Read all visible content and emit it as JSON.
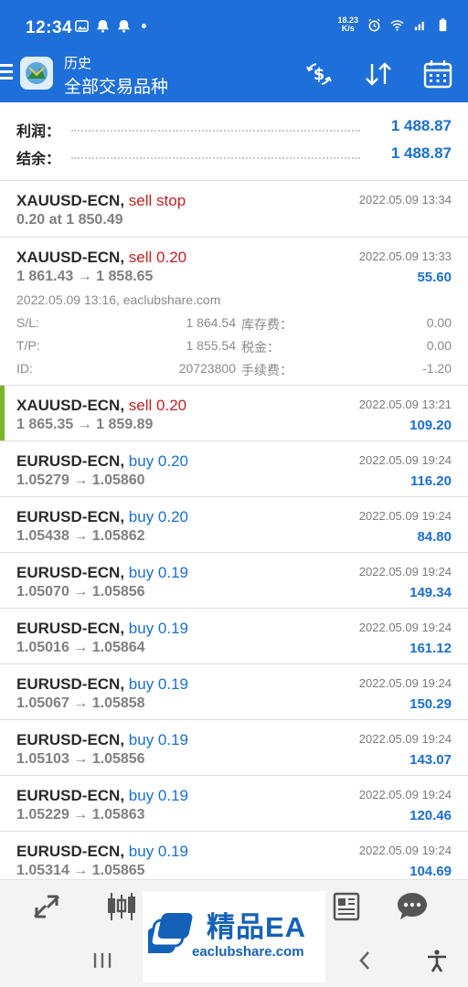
{
  "status_bar": {
    "time": "12:34",
    "speed_top": "18.23",
    "speed_bottom": "K/s",
    "left_icons": [
      "gallery-icon",
      "notification-icon",
      "notification-icon",
      "dot-indicator"
    ],
    "right_icons": [
      "alarm-icon",
      "wifi-icon",
      "signal-icon",
      "battery-icon"
    ]
  },
  "app_bar": {
    "subtitle": "历史",
    "title": "全部交易品种",
    "actions": [
      "currency-exchange-icon",
      "sort-icon",
      "calendar-icon"
    ],
    "bg_color": "#1e6fd9"
  },
  "summary": {
    "profit_label": "利润：",
    "profit_value": "1 488.87",
    "balance_label": "结余：",
    "balance_value": "1 488.87"
  },
  "trades": [
    {
      "symbol": "XAUUSD-ECN,",
      "side": "sell stop",
      "side_type": "sell",
      "date": "2022.05.09 13:34",
      "price": "0.20 at 1 850.49",
      "profit": ""
    },
    {
      "symbol": "XAUUSD-ECN,",
      "side": "sell 0.20",
      "side_type": "sell",
      "date": "2022.05.09 13:33",
      "price": "1 861.43 → 1 858.65",
      "profit": "55.60",
      "details": {
        "open_info": "2022.05.09 13:16, eaclubshare.com",
        "sl_label": "S/L:",
        "sl_value": "1 864.54",
        "swap_label": "库存费：",
        "swap_value": "0.00",
        "tp_label": "T/P:",
        "tp_value": "1 855.54",
        "tax_label": "税金：",
        "tax_value": "0.00",
        "id_label": "ID:",
        "id_value": "20723800",
        "fee_label": "手续费：",
        "fee_value": "-1.20"
      }
    },
    {
      "symbol": "XAUUSD-ECN,",
      "side": "sell 0.20",
      "side_type": "sell",
      "date": "2022.05.09 13:21",
      "price": "1 865.35 → 1 859.89",
      "profit": "109.20"
    },
    {
      "symbol": "EURUSD-ECN,",
      "side": "buy 0.20",
      "side_type": "buy",
      "date": "2022.05.09 19:24",
      "price": "1.05279 → 1.05860",
      "profit": "116.20"
    },
    {
      "symbol": "EURUSD-ECN,",
      "side": "buy 0.20",
      "side_type": "buy",
      "date": "2022.05.09 19:24",
      "price": "1.05438 → 1.05862",
      "profit": "84.80"
    },
    {
      "symbol": "EURUSD-ECN,",
      "side": "buy 0.19",
      "side_type": "buy",
      "date": "2022.05.09 19:24",
      "price": "1.05070 → 1.05856",
      "profit": "149.34"
    },
    {
      "symbol": "EURUSD-ECN,",
      "side": "buy 0.19",
      "side_type": "buy",
      "date": "2022.05.09 19:24",
      "price": "1.05016 → 1.05864",
      "profit": "161.12"
    },
    {
      "symbol": "EURUSD-ECN,",
      "side": "buy 0.19",
      "side_type": "buy",
      "date": "2022.05.09 19:24",
      "price": "1.05067 → 1.05858",
      "profit": "150.29"
    },
    {
      "symbol": "EURUSD-ECN,",
      "side": "buy 0.19",
      "side_type": "buy",
      "date": "2022.05.09 19:24",
      "price": "1.05103 → 1.05856",
      "profit": "143.07"
    },
    {
      "symbol": "EURUSD-ECN,",
      "side": "buy 0.19",
      "side_type": "buy",
      "date": "2022.05.09 19:24",
      "price": "1.05229 → 1.05863",
      "profit": "120.46"
    },
    {
      "symbol": "EURUSD-ECN,",
      "side": "buy 0.19",
      "side_type": "buy",
      "date": "2022.05.09 19:24",
      "price": "1.05314 → 1.05865",
      "profit": "104.69"
    }
  ],
  "bottom_nav": [
    "quotes-icon",
    "chart-icon",
    "trade-icon",
    "history-icon",
    "news-icon",
    "chat-icon"
  ],
  "system_nav": [
    "recent-apps-icon",
    "home-icon",
    "back-icon",
    "accessibility-icon"
  ],
  "watermark": {
    "title": "精品EA",
    "subtitle": "eaclubshare.com"
  },
  "colors": {
    "sell": "#c72020",
    "buy": "#1b6fcf",
    "profit": "#1b6fcf",
    "accent_bar": "#79b52c"
  }
}
